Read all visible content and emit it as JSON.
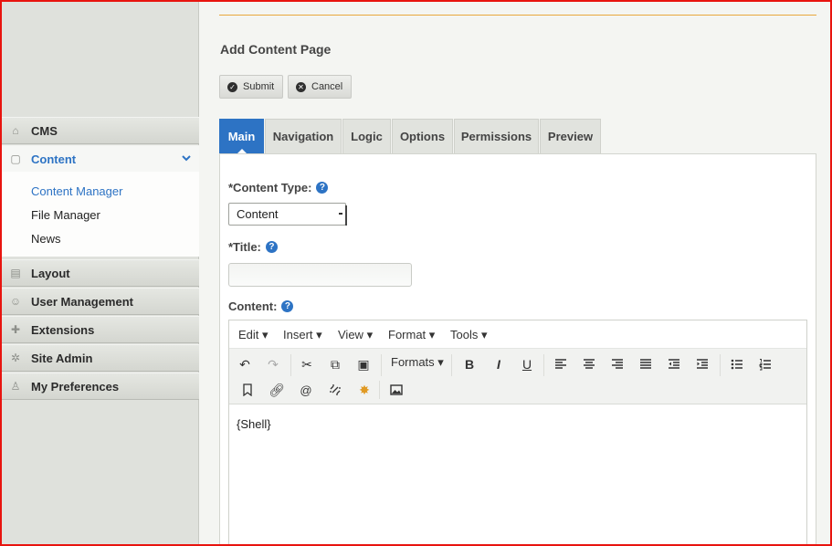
{
  "sidebar": {
    "groups": [
      {
        "label": "CMS",
        "icon": "home-icon"
      },
      {
        "label": "Content",
        "icon": "page-icon"
      },
      {
        "label": "Layout",
        "icon": "layout-icon"
      },
      {
        "label": "User Management",
        "icon": "users-icon"
      },
      {
        "label": "Extensions",
        "icon": "puzzle-icon"
      },
      {
        "label": "Site Admin",
        "icon": "gear-icon"
      },
      {
        "label": "My Preferences",
        "icon": "user-icon"
      }
    ],
    "content_items": [
      "Content Manager",
      "File Manager",
      "News"
    ]
  },
  "page": {
    "title": "Add Content Page",
    "submit_label": "Submit",
    "cancel_label": "Cancel"
  },
  "tabs": [
    "Main",
    "Navigation",
    "Logic",
    "Options",
    "Permissions",
    "Preview"
  ],
  "form": {
    "content_type_label": "*Content Type:",
    "content_type_value": "Content",
    "title_label": "*Title:",
    "title_value": "",
    "content_label": "Content:"
  },
  "editor": {
    "menus": [
      "Edit",
      "Insert",
      "View",
      "Format",
      "Tools"
    ],
    "formats_label": "Formats",
    "body": "{Shell}"
  },
  "colors": {
    "accent": "#2d73c4",
    "top_rule": "#e8a83c",
    "frame": "#e8140f"
  }
}
